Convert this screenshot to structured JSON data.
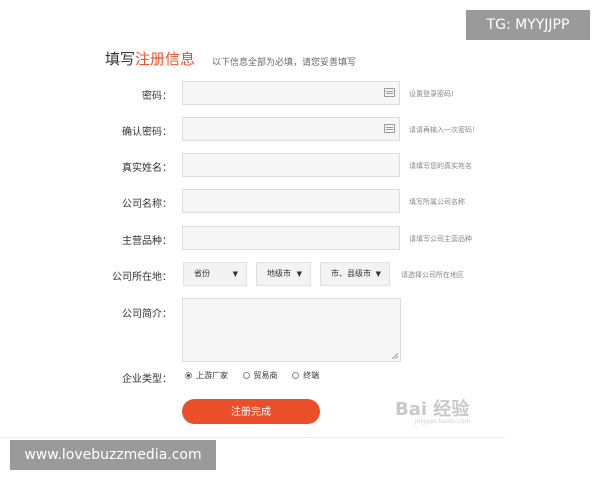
{
  "header": {
    "title_prefix": "填写",
    "title_accent": "注册信息",
    "subtitle": "以下信息全部为必填，请您妥善填写"
  },
  "colors": {
    "accent": "#e8532a",
    "button": "#ea4f2a"
  },
  "fields": {
    "password": {
      "label": "密码：",
      "hint": "设置登录密码!"
    },
    "confirm": {
      "label": "确认密码：",
      "hint": "请请再输入一次密码！"
    },
    "realname": {
      "label": "真实姓名：",
      "hint": "请填写您的真实姓名"
    },
    "company": {
      "label": "公司名称：",
      "hint": "填写所属公司名称"
    },
    "product": {
      "label": "主营品种：",
      "hint": "请填写公司主营品种"
    },
    "location": {
      "label": "公司所在地：",
      "province": "省份",
      "city": "地级市",
      "county": "市、县级市",
      "hint": "请选择公司所在地区"
    },
    "intro": {
      "label": "公司简介："
    },
    "type": {
      "label": "企业类型：",
      "options": [
        "上游厂家",
        "贸易商",
        "终端"
      ],
      "selected": "上游厂家"
    }
  },
  "submit_label": "注册完成",
  "overlays": {
    "top_right": "TG: MYYJJPP",
    "bottom_left": "www.lovebuzzmedia.com",
    "watermark": "Bai 经验",
    "watermark_sub": "jingyan.baidu.com"
  }
}
